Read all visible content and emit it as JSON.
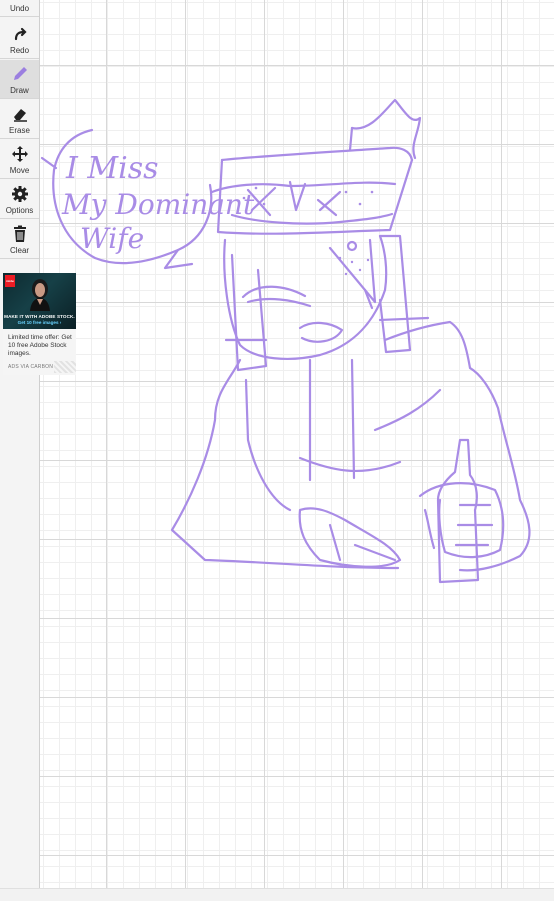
{
  "toolbar": {
    "undo_label": "Undo",
    "redo_label": "Redo",
    "draw_label": "Draw",
    "erase_label": "Erase",
    "move_label": "Move",
    "options_label": "Options",
    "clear_label": "Clear",
    "active_tool": "Draw"
  },
  "icons": {
    "undo": "undo-arrow-icon",
    "redo": "redo-arrow-icon",
    "draw": "pencil-icon",
    "erase": "eraser-icon",
    "move": "move-arrows-icon",
    "options": "gear-icon",
    "clear": "trash-icon"
  },
  "colors": {
    "stroke": "#a98ce6",
    "pencil_active": "#9b7fe0",
    "toolbar_bg": "#f4f4f4"
  },
  "ad": {
    "logo_text": "Adobe",
    "headline": "MAKE IT WITH ADOBE STOCK.",
    "subheadline": "Get 10 free images ›",
    "text": "Limited time offer: Get 10 free Adobe Stock images.",
    "via": "ADS VIA CARBON"
  },
  "drawing": {
    "speech_line1": "I Miss",
    "speech_line2": "My Dominant",
    "speech_line3": "Wife"
  }
}
